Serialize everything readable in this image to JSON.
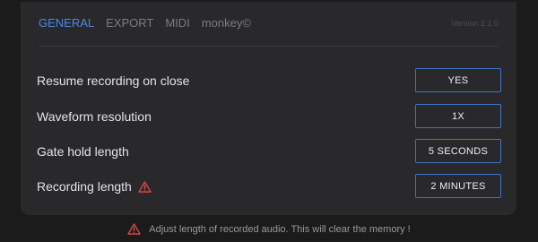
{
  "tabs": [
    {
      "label": "GENERAL",
      "active": true
    },
    {
      "label": "EXPORT",
      "active": false
    },
    {
      "label": "MIDI",
      "active": false
    },
    {
      "label": "monkey©",
      "active": false
    }
  ],
  "version": "Version 2.1.0",
  "settings": [
    {
      "label": "Resume recording on close",
      "value": "YES"
    },
    {
      "label": "Waveform resolution",
      "value": "1X"
    },
    {
      "label": "Gate hold length",
      "value": "5 SECONDS"
    },
    {
      "label": "Recording length",
      "value": "2 MINUTES",
      "warning": true
    }
  ],
  "footer": {
    "message": "Adjust length of recorded audio. This will clear the memory !",
    "icon": "warning-triangle-icon"
  },
  "colors": {
    "accent": "#4d86e0",
    "button_border": "#3f74c4",
    "warning": "#e24a4a",
    "panel": "#29292b",
    "background": "#1b1b1c"
  }
}
